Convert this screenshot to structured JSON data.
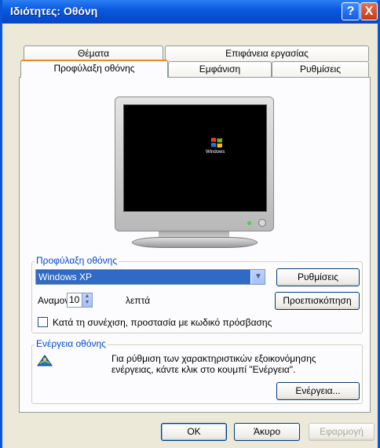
{
  "window": {
    "title": "Ιδιότητες: Οθόνη"
  },
  "titlebar_buttons": {
    "help": "?",
    "close": "X"
  },
  "tabs": {
    "themes": "Θέματα",
    "desktop": "Επιφάνεια εργασίας",
    "screensaver": "Προφύλαξη οθόνης",
    "appearance": "Εμφάνιση",
    "settings": "Ρυθμίσεις",
    "active": "screensaver"
  },
  "preview": {
    "screen_text": "Windows"
  },
  "screensaver": {
    "group_label": "Προφύλαξη οθόνης",
    "selected": "Windows XP",
    "settings_button": "Ρυθμίσεις",
    "preview_button": "Προεπισκόπηση",
    "wait_label": "Αναμονή:",
    "wait_value": "10",
    "wait_unit": "λεπτά",
    "password_checkbox_label": "Κατά τη συνέχιση, προστασία με κωδικό πρόσβασης",
    "password_checked": false
  },
  "power": {
    "group_label": "Ενέργεια οθόνης",
    "description_line1": "Για ρύθμιση των χαρακτηριστικών εξοικονόμησης",
    "description_line2": "ενέργειας, κάντε κλικ στο κουμπί \"Ενέργεια\".",
    "power_button": "Ενέργεια..."
  },
  "dialog_buttons": {
    "ok": "OK",
    "cancel": "Άκυρο",
    "apply": "Εφαρμογή"
  }
}
